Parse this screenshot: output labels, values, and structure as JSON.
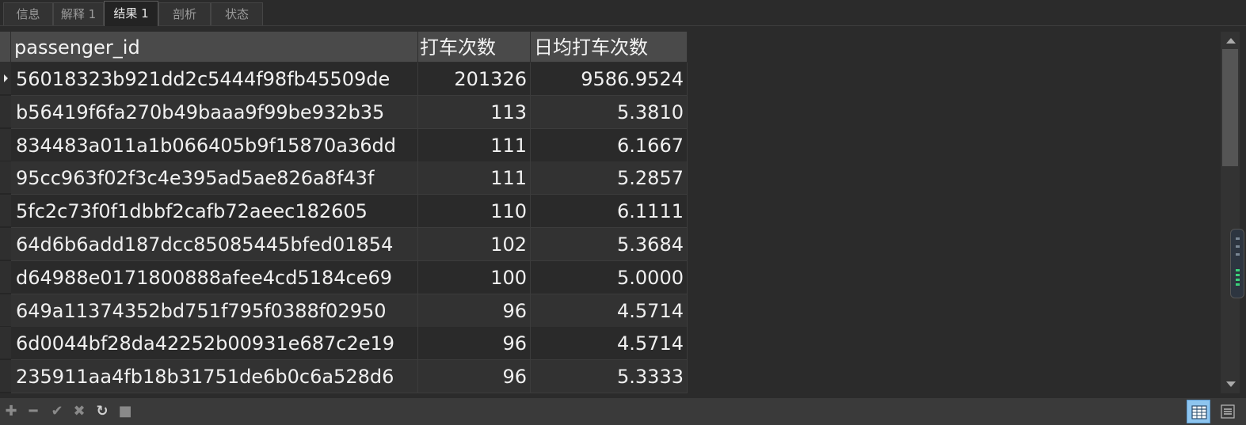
{
  "tabs": [
    {
      "label": "信息",
      "active": false
    },
    {
      "label": "解释 1",
      "active": false
    },
    {
      "label": "结果 1",
      "active": true
    },
    {
      "label": "剖析",
      "active": false
    },
    {
      "label": "状态",
      "active": false
    }
  ],
  "grid": {
    "columns": [
      "passenger_id",
      "打车次数",
      "日均打车次数"
    ],
    "rows": [
      [
        "56018323b921dd2c5444f98fb45509de",
        "201326",
        "9586.9524"
      ],
      [
        "b56419f6fa270b49baaa9f99be932b35",
        "113",
        "5.3810"
      ],
      [
        "834483a011a1b066405b9f15870a36dd",
        "111",
        "6.1667"
      ],
      [
        "95cc963f02f3c4e395ad5ae826a8f43f",
        "111",
        "5.2857"
      ],
      [
        "5fc2c73f0f1dbbf2cafb72aeec182605",
        "110",
        "6.1111"
      ],
      [
        "64d6b6add187dcc85085445bfed01854",
        "102",
        "5.3684"
      ],
      [
        "d64988e0171800888afee4cd5184ce69",
        "100",
        "5.0000"
      ],
      [
        "649a11374352bd751f795f0388f02950",
        "96",
        "4.5714"
      ],
      [
        "6d0044bf28da42252b00931e687c2e19",
        "96",
        "4.5714"
      ],
      [
        "235911aa4fb18b31751de6b0c6a528d6",
        "96",
        "5.3333"
      ]
    ]
  },
  "toolbar": {
    "add_icon": "plus-icon",
    "delete_icon": "minus-icon",
    "apply_icon": "check-icon",
    "discard_icon": "x-icon",
    "refresh_icon": "refresh-icon",
    "stop_icon": "stop-icon",
    "grid_view_icon": "grid-view-icon",
    "form_view_icon": "form-view-icon"
  },
  "colors": {
    "background": "#2b2b2b",
    "header": "#4a4a4a",
    "active_view": "#8ec5ef"
  }
}
